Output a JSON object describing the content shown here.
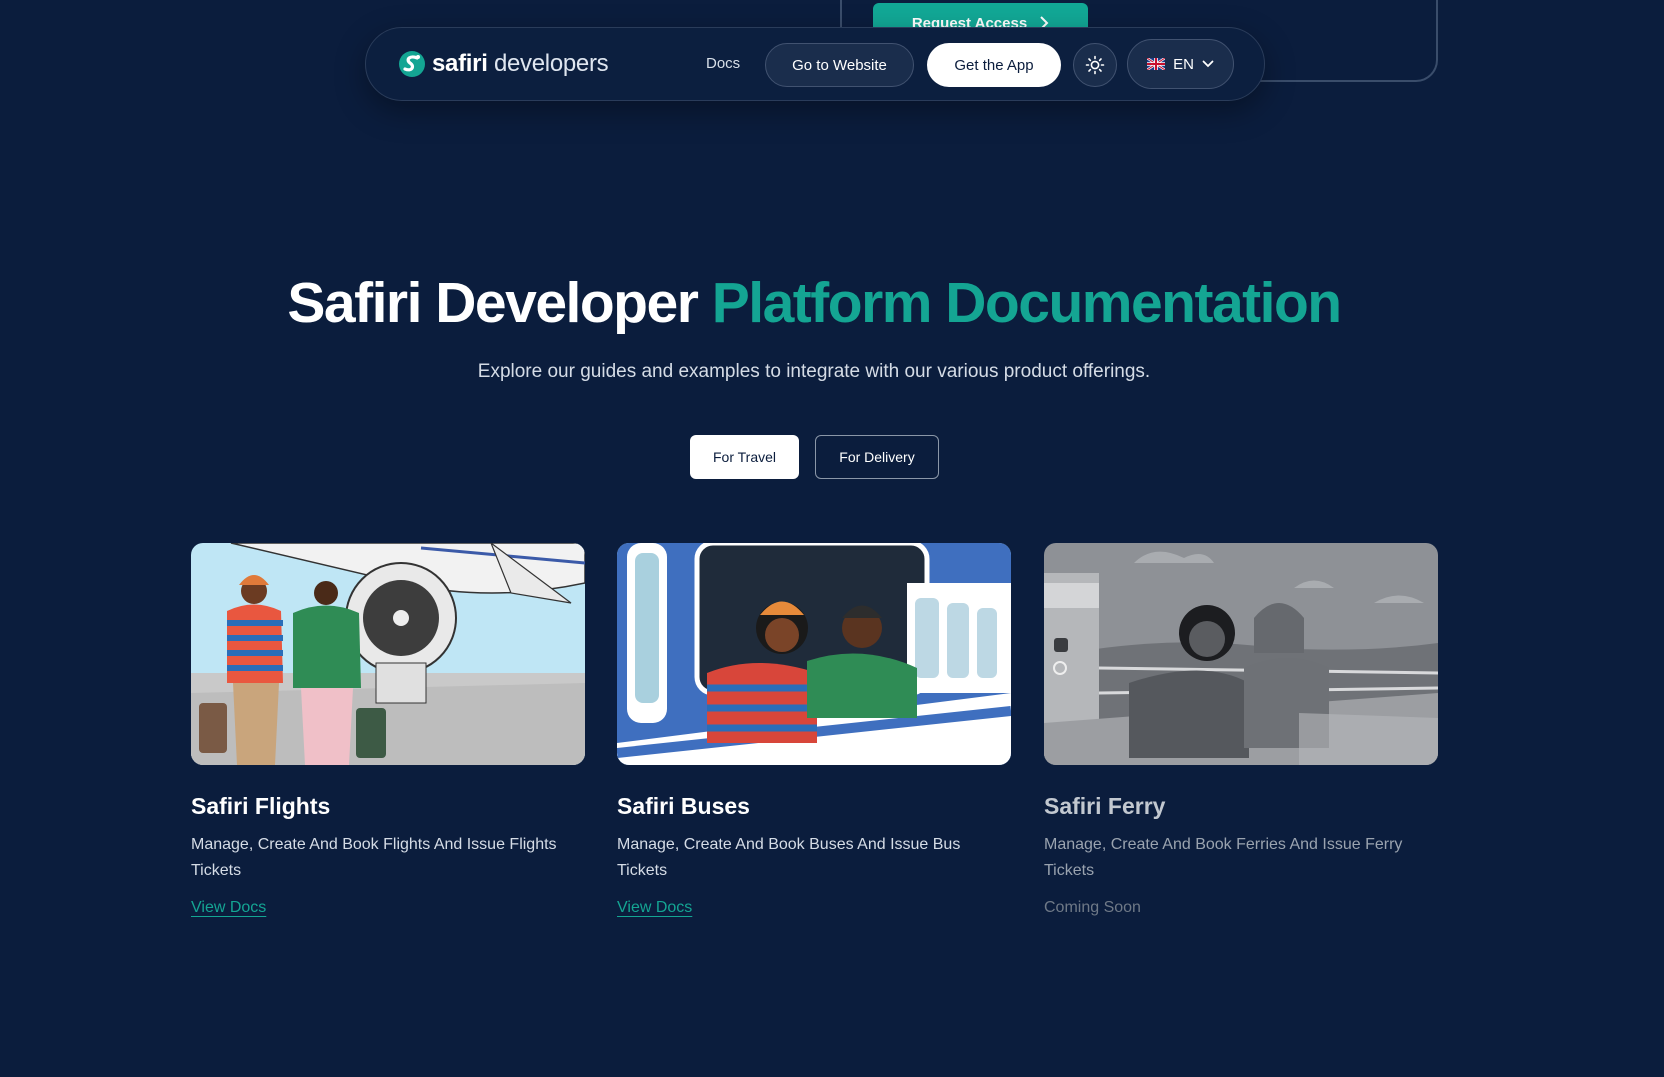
{
  "background": {
    "request_access_label": "Request Access"
  },
  "nav": {
    "logo_bold": "safiri",
    "logo_light": " developers",
    "docs": "Docs",
    "go_to_website": "Go to Website",
    "get_app": "Get the App",
    "lang": "EN"
  },
  "hero": {
    "title_part1": "Safiri Developer ",
    "title_part2": "Platform Documentation",
    "subtitle": "Explore our guides and examples to integrate with our various product offerings."
  },
  "tabs": [
    {
      "label": "For Travel",
      "active": true
    },
    {
      "label": "For Delivery",
      "active": false
    }
  ],
  "cards": [
    {
      "title": "Safiri Flights",
      "desc": "Manage, Create And Book Flights And Issue Flights Tickets",
      "link": "View Docs"
    },
    {
      "title": "Safiri Buses",
      "desc": "Manage, Create And Book Buses And Issue Bus Tickets",
      "link": "View Docs"
    },
    {
      "title": "Safiri Ferry",
      "desc": "Manage, Create And Book Ferries And Issue Ferry Tickets",
      "link": "Coming Soon"
    }
  ],
  "colors": {
    "bg": "#0b1d3d",
    "accent": "#14a593"
  }
}
